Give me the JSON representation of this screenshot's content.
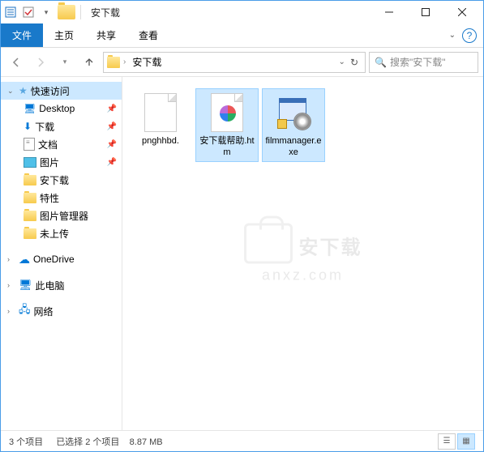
{
  "titlebar": {
    "title": "安下载"
  },
  "ribbon": {
    "file": "文件",
    "home": "主页",
    "share": "共享",
    "view": "查看"
  },
  "address": {
    "crumb": "安下载"
  },
  "search": {
    "placeholder": "搜索\"安下载\""
  },
  "sidebar": {
    "quick": "快速访问",
    "desktop": "Desktop",
    "downloads": "下载",
    "documents": "文档",
    "pictures": "图片",
    "anxz": "安下载",
    "props": "特性",
    "picmgr": "图片管理器",
    "unupload": "未上传",
    "onedrive": "OneDrive",
    "thispc": "此电脑",
    "network": "网络"
  },
  "files": [
    {
      "name": "pnghhbd.",
      "type": "blank",
      "selected": false
    },
    {
      "name": "安下载帮助.htm",
      "type": "htm",
      "selected": true
    },
    {
      "name": "filmmanager.exe",
      "type": "exe",
      "selected": true
    }
  ],
  "watermark": {
    "line1": "安下载",
    "line2": "anxz.com"
  },
  "status": {
    "items": "3 个项目",
    "selected": "已选择 2 个项目",
    "size": "8.87 MB"
  }
}
